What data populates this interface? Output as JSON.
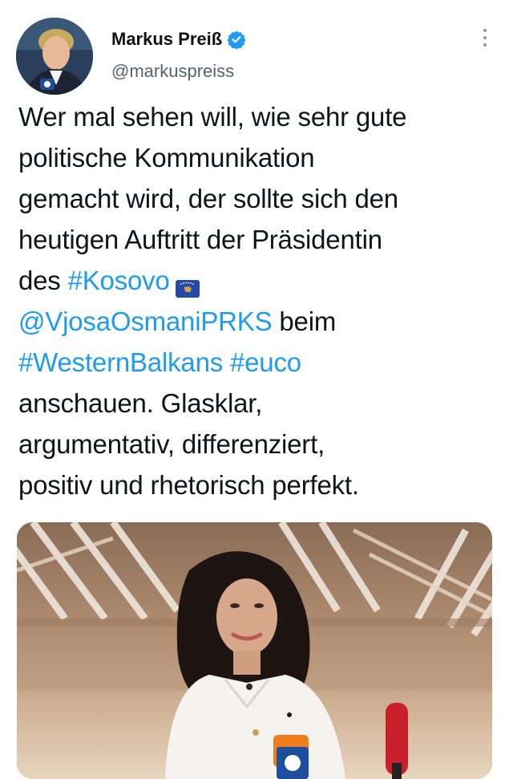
{
  "author": {
    "display_name": "Markus Preiß",
    "handle": "@markuspreiss",
    "verified": true
  },
  "icons": {
    "verified": "verified-badge-icon",
    "more": "more-options-icon",
    "flag": "kosovo-flag-emoji"
  },
  "tweet": {
    "lines": [
      [
        {
          "t": "Wer mal sehen will, wie sehr gute"
        }
      ],
      [
        {
          "t": "politische Kommunikation"
        }
      ],
      [
        {
          "t": "gemacht wird, der sollte sich den"
        }
      ],
      [
        {
          "t": "heutigen Auftritt der Präsidentin"
        }
      ],
      [
        {
          "t": "des "
        },
        {
          "t": "#Kosovo",
          "link": true
        }
      ],
      [
        {
          "t": "@VjosaOsmaniPRKS",
          "link": true
        },
        {
          "t": " beim"
        }
      ],
      [
        {
          "t": "#WesternBalkans",
          "link": true
        },
        {
          "t": " "
        },
        {
          "t": "#euco",
          "link": true
        }
      ],
      [
        {
          "t": "anschauen. Glasklar,"
        }
      ],
      [
        {
          "t": "argumentativ, differenziert,"
        }
      ],
      [
        {
          "t": "positiv und rhetorisch perfekt."
        }
      ]
    ]
  },
  "media": {
    "type": "photo",
    "subject": "woman-interview"
  },
  "colors": {
    "text": "#0f1419",
    "secondary": "#536471",
    "link": "#1d9bf0",
    "verified": "#1d9bf0"
  }
}
